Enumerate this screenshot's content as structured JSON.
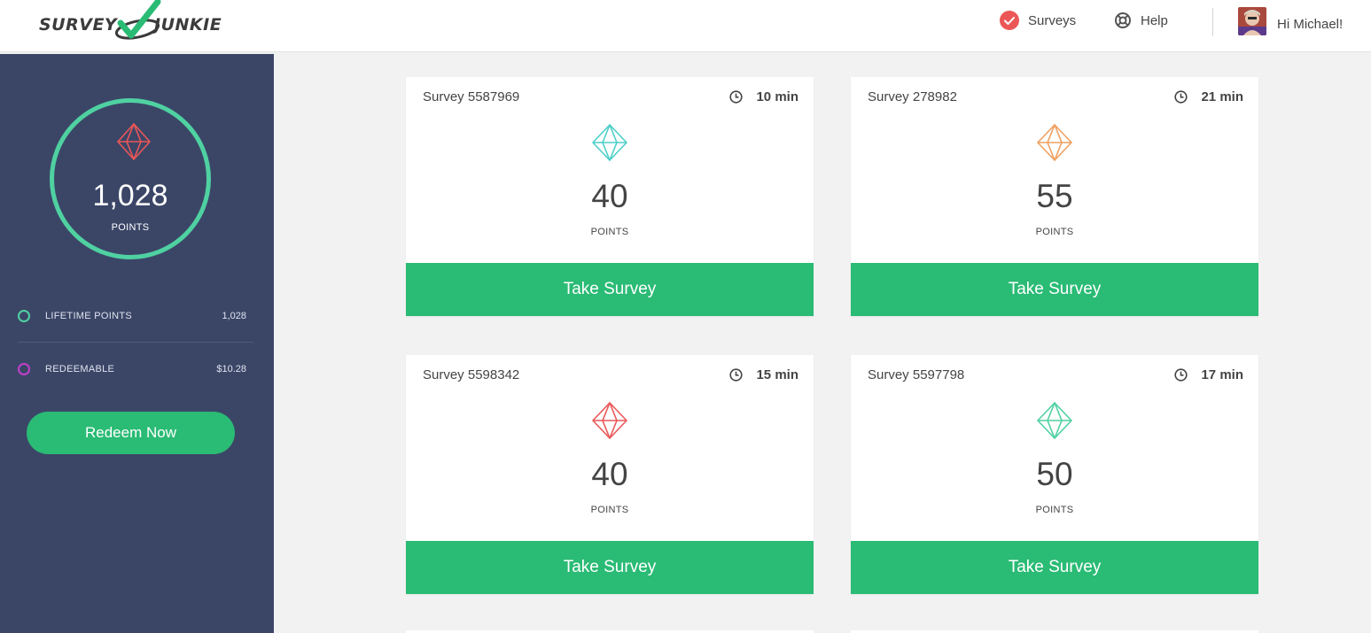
{
  "header": {
    "logo_left": "SURVEY",
    "logo_right": "JUNKIE",
    "nav": {
      "surveys_label": "Surveys",
      "help_label": "Help"
    },
    "user": {
      "greeting": "Hi Michael!"
    }
  },
  "sidebar": {
    "points_value": "1,028",
    "points_label": "POINTS",
    "stats": [
      {
        "label": "LIFETIME POINTS",
        "value": "1,028",
        "color": "#4fd1a1"
      },
      {
        "label": "REDEEMABLE",
        "value": "$10.28",
        "color": "#c13fc9"
      }
    ],
    "redeem_label": "Redeem Now"
  },
  "surveys": [
    {
      "title": "Survey 5587969",
      "time": "10 min",
      "points": "40",
      "points_label": "POINTS",
      "button": "Take Survey",
      "gem_color": "#4dcfc8"
    },
    {
      "title": "Survey 278982",
      "time": "21 min",
      "points": "55",
      "points_label": "POINTS",
      "button": "Take Survey",
      "gem_color": "#efa061"
    },
    {
      "title": "Survey 5598342",
      "time": "15 min",
      "points": "40",
      "points_label": "POINTS",
      "button": "Take Survey",
      "gem_color": "#eb5757"
    },
    {
      "title": "Survey 5597798",
      "time": "17 min",
      "points": "50",
      "points_label": "POINTS",
      "button": "Take Survey",
      "gem_color": "#4fd1a1"
    }
  ],
  "colors": {
    "accent_green": "#2abb75",
    "sidebar_bg": "#3b4667",
    "ring": "#4fd1a1",
    "sidebar_gem": "#eb5757",
    "surveys_icon": "#eb5757"
  }
}
